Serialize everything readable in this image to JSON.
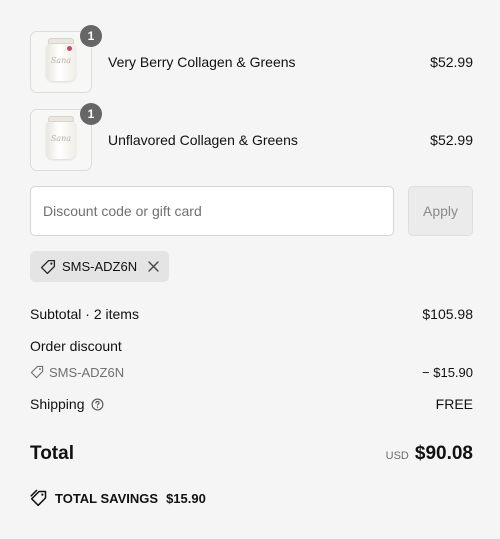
{
  "line_items": [
    {
      "name": "Very Berry Collagen & Greens",
      "price": "$52.99",
      "quantity": "1",
      "thumbnail_icon": "collagen-jar-berry"
    },
    {
      "name": "Unflavored Collagen & Greens",
      "price": "$52.99",
      "quantity": "1",
      "thumbnail_icon": "collagen-jar-unflavored"
    }
  ],
  "discount": {
    "placeholder": "Discount code or gift card",
    "value": "",
    "apply_label": "Apply"
  },
  "applied_code": {
    "code": "SMS-ADZ6N",
    "icon": "tag-icon",
    "remove_icon": "close-icon"
  },
  "summary": {
    "subtotal_label": "Subtotal · 2 items",
    "subtotal_value": "$105.98",
    "order_discount_label": "Order discount",
    "discount_code": "SMS-ADZ6N",
    "discount_value": "− $15.90",
    "shipping_label": "Shipping",
    "shipping_value": "FREE",
    "total_label": "Total",
    "currency": "USD",
    "total_value": "$90.08",
    "savings_label": "TOTAL SAVINGS",
    "savings_value": "$15.90"
  },
  "colors": {
    "background": "#f5f5f5",
    "badge": "#666666",
    "chip_background": "#e4e4e4",
    "apply_button": "#ebebeb"
  }
}
